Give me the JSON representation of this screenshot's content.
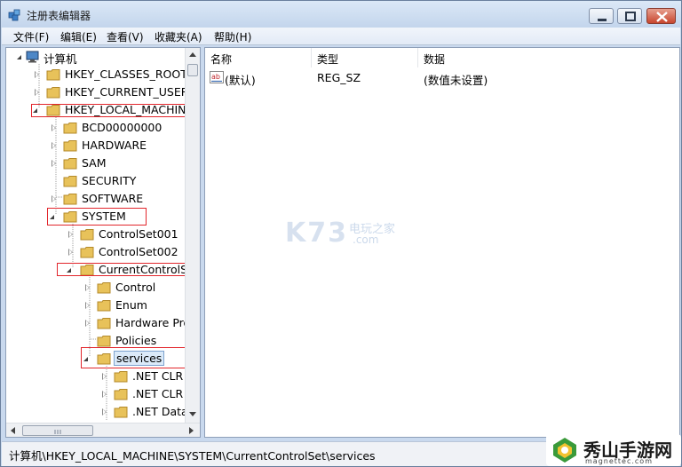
{
  "window": {
    "title": "注册表编辑器"
  },
  "menu": [
    "文件(F)",
    "编辑(E)",
    "查看(V)",
    "收藏夹(A)",
    "帮助(H)"
  ],
  "tree": {
    "root": "计算机",
    "items": [
      {
        "label": "HKEY_CLASSES_ROOT"
      },
      {
        "label": "HKEY_CURRENT_USER"
      },
      {
        "label": "HKEY_LOCAL_MACHINE"
      },
      {
        "label": "BCD00000000"
      },
      {
        "label": "HARDWARE"
      },
      {
        "label": "SAM"
      },
      {
        "label": "SECURITY"
      },
      {
        "label": "SOFTWARE"
      },
      {
        "label": "SYSTEM"
      },
      {
        "label": "ControlSet001"
      },
      {
        "label": "ControlSet002"
      },
      {
        "label": "CurrentControlSet"
      },
      {
        "label": "Control"
      },
      {
        "label": "Enum"
      },
      {
        "label": "Hardware Profiles"
      },
      {
        "label": "Policies"
      },
      {
        "label": "services"
      },
      {
        "label": ".NET CLR"
      },
      {
        "label": ".NET CLR"
      },
      {
        "label": ".NET Data"
      }
    ]
  },
  "list": {
    "columns": [
      "名称",
      "类型",
      "数据"
    ],
    "rows": [
      {
        "name": "(默认)",
        "type": "REG_SZ",
        "data": "(数值未设置)"
      }
    ]
  },
  "status": {
    "path": "计算机\\HKEY_LOCAL_MACHINE\\SYSTEM\\CurrentControlSet\\services"
  },
  "watermarks": {
    "center_logo": "K73",
    "center_cn": "电玩之家",
    "center_url": ".com",
    "corner_logo": "秀山手游网",
    "corner_url": "magnettec.com"
  },
  "colors": {
    "highlight_box": "#e2262c",
    "selection": "#dbeaf9",
    "folder": "#e8c25a"
  }
}
